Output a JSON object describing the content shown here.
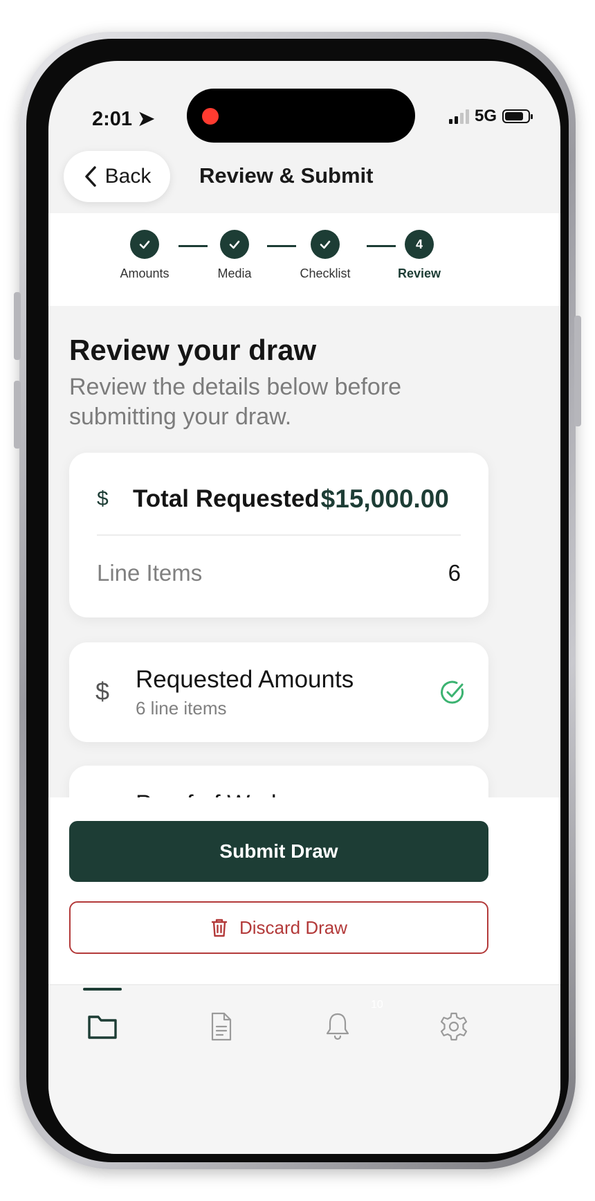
{
  "status_bar": {
    "time": "2:01",
    "network": "5G"
  },
  "header": {
    "back_label": "Back",
    "title": "Review & Submit"
  },
  "stepper": {
    "steps": [
      {
        "label": "Amounts",
        "state": "complete"
      },
      {
        "label": "Media",
        "state": "complete"
      },
      {
        "label": "Checklist",
        "state": "complete"
      },
      {
        "label": "Review",
        "state": "active",
        "number": "4"
      }
    ]
  },
  "page": {
    "title": "Review your draw",
    "subtitle": "Review the details below before submitting your draw."
  },
  "summary": {
    "total_icon": "$",
    "total_label": "Total Requested",
    "total_value": "$15,000.00",
    "line_items_label": "Line Items",
    "line_items_value": "6"
  },
  "sections": {
    "requested_amounts": {
      "icon": "$",
      "title": "Requested Amounts",
      "subtitle": "6 line items",
      "status": "complete"
    },
    "proof_of_work": {
      "title": "Proof of Work"
    }
  },
  "actions": {
    "submit_label": "Submit Draw",
    "discard_label": "Discard Draw"
  },
  "tab_bar": {
    "items": [
      {
        "icon": "folder-icon",
        "active": true
      },
      {
        "icon": "document-icon",
        "active": false
      },
      {
        "icon": "bell-icon",
        "active": false
      },
      {
        "icon": "gear-icon",
        "active": false
      }
    ],
    "notification_badge": "10"
  },
  "colors": {
    "brand": "#1d3d35",
    "danger": "#b33a3a",
    "success": "#3cb371",
    "background": "#f3f3f3"
  }
}
